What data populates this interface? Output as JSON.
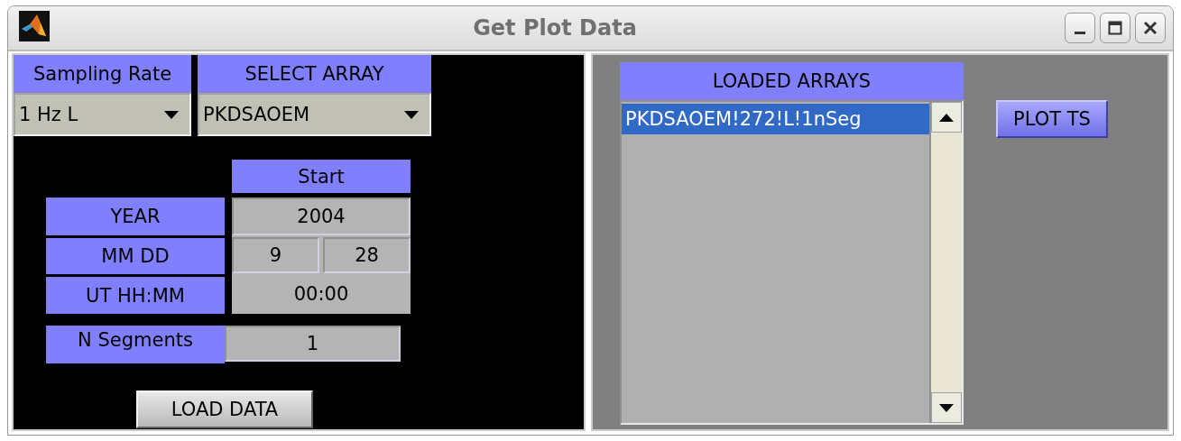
{
  "window": {
    "title": "Get Plot Data"
  },
  "sampling_rate": {
    "label": "Sampling Rate",
    "value": "1 Hz L"
  },
  "select_array": {
    "label": "SELECT ARRAY",
    "value": "PKDSAOEM"
  },
  "start": {
    "label": "Start",
    "year_label": "YEAR",
    "year": "2004",
    "mmdd_label": "MM DD",
    "month": "9",
    "day": "28",
    "time_label": "UT HH:MM",
    "time": "00:00"
  },
  "n_segments": {
    "label": "N Segments",
    "value": "1"
  },
  "load_button": "LOAD DATA",
  "loaded_arrays": {
    "label": "LOADED ARRAYS",
    "items": [
      {
        "label": "PKDSAOEM!272!L!1nSeg",
        "selected": true
      }
    ]
  },
  "plot_button": "PLOT TS"
}
